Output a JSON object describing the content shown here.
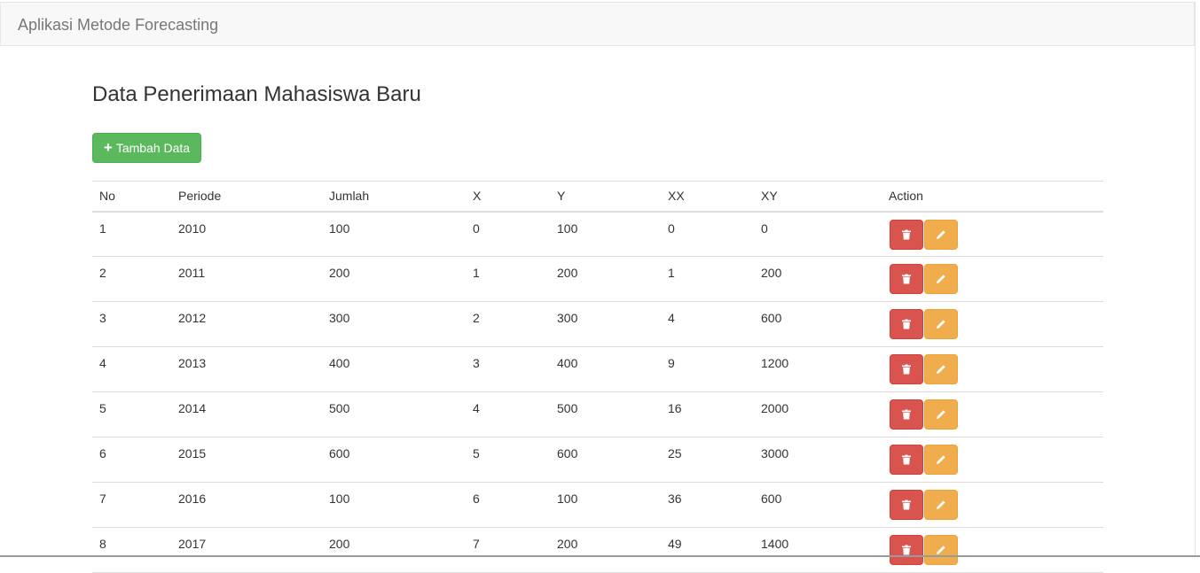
{
  "navbar": {
    "brand": "Aplikasi Metode Forecasting"
  },
  "page": {
    "title": "Data Penerimaan Mahasiswa Baru"
  },
  "toolbar": {
    "add_label": "Tambah Data",
    "add_icon": "plus-icon"
  },
  "colors": {
    "success": "#5cb85c",
    "danger": "#d9534f",
    "warning": "#f0ad4e"
  },
  "table": {
    "headers": [
      "No",
      "Periode",
      "Jumlah",
      "X",
      "Y",
      "XX",
      "XY",
      "Action"
    ],
    "rows": [
      [
        "1",
        "2010",
        "100",
        "0",
        "100",
        "0",
        "0"
      ],
      [
        "2",
        "2011",
        "200",
        "1",
        "200",
        "1",
        "200"
      ],
      [
        "3",
        "2012",
        "300",
        "2",
        "300",
        "4",
        "600"
      ],
      [
        "4",
        "2013",
        "400",
        "3",
        "400",
        "9",
        "1200"
      ],
      [
        "5",
        "2014",
        "500",
        "4",
        "500",
        "16",
        "2000"
      ],
      [
        "6",
        "2015",
        "600",
        "5",
        "600",
        "25",
        "3000"
      ],
      [
        "7",
        "2016",
        "100",
        "6",
        "100",
        "36",
        "600"
      ],
      [
        "8",
        "2017",
        "200",
        "7",
        "200",
        "49",
        "1400"
      ]
    ],
    "row_actions": [
      {
        "name": "delete",
        "icon": "trash-icon"
      },
      {
        "name": "edit",
        "icon": "pencil-icon"
      }
    ]
  }
}
